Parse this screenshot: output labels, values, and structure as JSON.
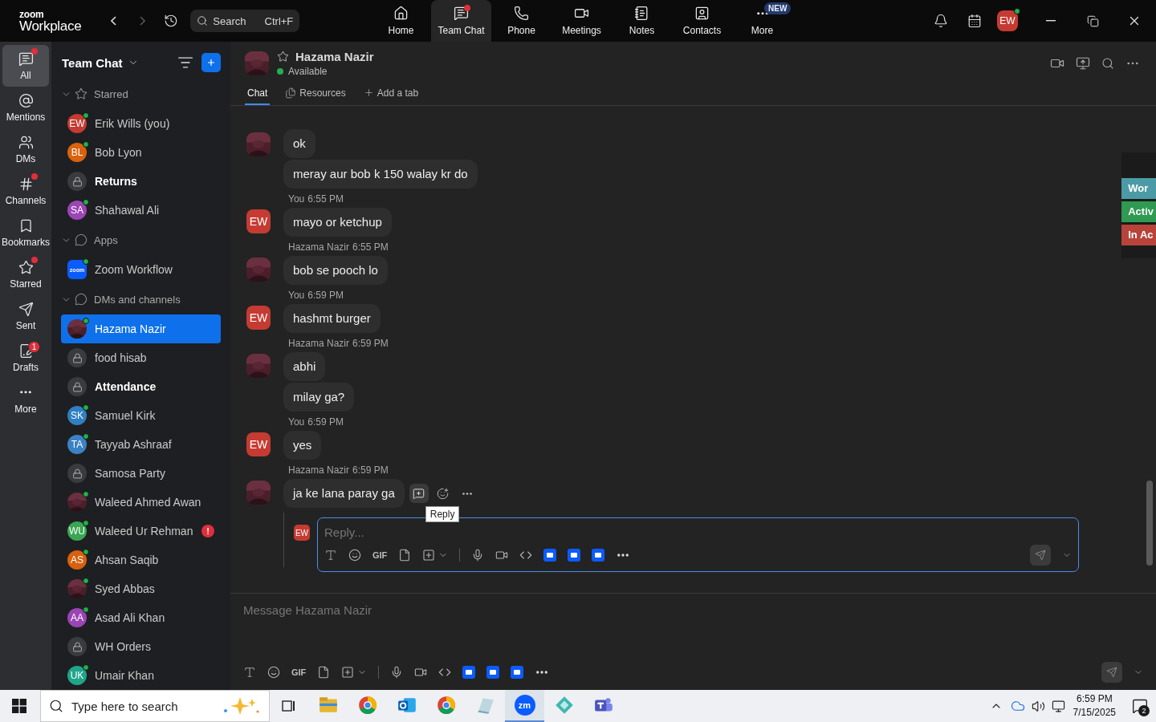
{
  "app": {
    "logo_top": "zoom",
    "logo_bottom": "Workplace"
  },
  "top_bar": {
    "search": {
      "placeholder": "Search",
      "shortcut": "Ctrl+F"
    },
    "nav": [
      {
        "label": "Home",
        "selected": false,
        "dot": false
      },
      {
        "label": "Team Chat",
        "selected": true,
        "dot": true
      },
      {
        "label": "Phone",
        "selected": false,
        "dot": false
      },
      {
        "label": "Meetings",
        "selected": false,
        "dot": false
      },
      {
        "label": "Notes",
        "selected": false,
        "dot": false
      },
      {
        "label": "Contacts",
        "selected": false,
        "dot": false
      },
      {
        "label": "More",
        "selected": false,
        "dot": false,
        "badge": "NEW"
      }
    ],
    "avatar": {
      "initials": "EW",
      "online": true
    }
  },
  "rail": [
    {
      "label": "All",
      "selected": true,
      "dot": true
    },
    {
      "label": "Mentions",
      "selected": false,
      "dot": false
    },
    {
      "label": "DMs",
      "selected": false,
      "dot": false
    },
    {
      "label": "Channels",
      "selected": false,
      "dot": true
    },
    {
      "label": "Bookmarks",
      "selected": false,
      "dot": false
    },
    {
      "label": "Starred",
      "selected": false,
      "dot": true
    },
    {
      "label": "Sent",
      "selected": false,
      "dot": false
    },
    {
      "label": "Drafts",
      "selected": false,
      "dot": false,
      "badge": "1"
    },
    {
      "label": "More",
      "selected": false,
      "dot": false
    }
  ],
  "sidebar": {
    "title": "Team Chat",
    "sections": [
      {
        "title": "Starred",
        "expanded": true,
        "items": [
          {
            "name": "Erik Wills (you)",
            "kind": "initials",
            "initials": "EW",
            "color": "#c53b32",
            "online": true,
            "unread": false,
            "selected": false
          },
          {
            "name": "Bob Lyon",
            "kind": "initials",
            "initials": "BL",
            "color": "#d9620e",
            "online": true,
            "unread": false,
            "selected": false
          },
          {
            "name": "Returns",
            "kind": "lock",
            "online": false,
            "unread": true,
            "selected": false
          },
          {
            "name": "Shahawal Ali",
            "kind": "initials",
            "initials": "SA",
            "color": "#9b46b5",
            "online": true,
            "unread": false,
            "selected": false
          }
        ]
      },
      {
        "title": "Apps",
        "expanded": true,
        "items": [
          {
            "name": "Zoom Workflow",
            "kind": "app",
            "initials": "zoom",
            "online": true,
            "unread": false,
            "selected": false
          }
        ]
      },
      {
        "title": "DMs and channels",
        "expanded": true,
        "items": [
          {
            "name": "Hazama Nazir",
            "online": true,
            "unread": false,
            "selected": true
          },
          {
            "name": "food hisab",
            "kind": "lock",
            "online": false,
            "unread": false,
            "selected": false
          },
          {
            "name": "Attendance",
            "kind": "lock",
            "online": false,
            "unread": true,
            "selected": false
          },
          {
            "name": "Samuel Kirk",
            "kind": "initials",
            "initials": "SK",
            "color": "#2f7fc1",
            "online": true,
            "unread": false,
            "selected": false
          },
          {
            "name": "Tayyab Ashraaf",
            "kind": "initials",
            "initials": "TA",
            "color": "#3b82c4",
            "online": true,
            "unread": false,
            "selected": false
          },
          {
            "name": "Samosa Party",
            "kind": "lock",
            "online": false,
            "unread": false,
            "selected": false
          },
          {
            "name": "Waleed Ahmed Awan",
            "online": true,
            "unread": false,
            "selected": false
          },
          {
            "name": "Waleed Ur Rehman",
            "kind": "initials",
            "initials": "WU",
            "color": "#3aa655",
            "online": true,
            "unread": false,
            "selected": false,
            "alert": "!"
          },
          {
            "name": "Ahsan Saqib",
            "kind": "initials",
            "initials": "AS",
            "color": "#d8600f",
            "online": true,
            "unread": false,
            "selected": false
          },
          {
            "name": "Syed Abbas",
            "online": true,
            "unread": false,
            "selected": false
          },
          {
            "name": "Asad Ali Khan",
            "kind": "initials",
            "initials": "AA",
            "color": "#9a45b4",
            "online": true,
            "unread": false,
            "selected": false
          },
          {
            "name": "WH Orders",
            "kind": "lock",
            "online": false,
            "unread": false,
            "selected": false
          },
          {
            "name": "Umair Khan",
            "kind": "initials",
            "initials": "UK",
            "color": "#1fa58a",
            "online": true,
            "unread": false,
            "selected": false
          }
        ]
      }
    ]
  },
  "chat": {
    "header": {
      "name": "Hazama Nazir",
      "status": "Available",
      "online": true
    },
    "tabs": [
      {
        "label": "Chat",
        "selected": true
      },
      {
        "label": "Resources",
        "selected": false
      }
    ],
    "add_tab": "Add a tab"
  },
  "messages": [
    {
      "bubbles": [
        "ok",
        "meray aur bob k 150 walay kr do"
      ],
      "hovered": false
    },
    {
      "initials": "EW",
      "sender": "You",
      "time": "6:55 PM",
      "bubbles": [
        "mayo or ketchup"
      ],
      "hovered": false
    },
    {
      "sender": "Hazama Nazir",
      "time": "6:55 PM",
      "bubbles": [
        "bob se pooch lo"
      ],
      "hovered": false
    },
    {
      "initials": "EW",
      "sender": "You",
      "time": "6:59 PM",
      "bubbles": [
        "hashmt burger"
      ],
      "hovered": false
    },
    {
      "sender": "Hazama Nazir",
      "time": "6:59 PM",
      "bubbles": [
        "abhi",
        "milay ga?"
      ],
      "hovered": false
    },
    {
      "initials": "EW",
      "sender": "You",
      "time": "6:59 PM",
      "bubbles": [
        "yes"
      ],
      "hovered": false
    },
    {
      "sender": "Hazama Nazir",
      "time": "6:59 PM",
      "bubbles": [
        "ja ke lana paray ga"
      ],
      "hovered": true,
      "tooltip": "Reply"
    }
  ],
  "reply_box": {
    "initials": "EW",
    "placeholder": "Reply...",
    "gif": "GIF"
  },
  "side_tags": [
    {
      "label": "Wor",
      "color": "#4b9ba6"
    },
    {
      "label": "Activ",
      "color": "#2e9a52"
    },
    {
      "label": "In Ac",
      "color": "#b8433b"
    }
  ],
  "composer": {
    "placeholder": "Message Hazama Nazir",
    "gif": "GIF"
  },
  "taskbar": {
    "search_placeholder": "Type here to search",
    "apps": [
      {
        "kind": "folder",
        "selected": false
      },
      {
        "kind": "chrome",
        "selected": false
      },
      {
        "kind": "outlook",
        "selected": false
      },
      {
        "kind": "chrome",
        "selected": false
      },
      {
        "kind": "notes",
        "selected": false
      },
      {
        "kind": "zoom",
        "text": "zm",
        "selected": true
      },
      {
        "kind": "diamond",
        "selected": false
      },
      {
        "kind": "teams",
        "selected": false
      }
    ],
    "time": "6:59 PM",
    "date": "7/15/2025",
    "notifications": "2"
  }
}
